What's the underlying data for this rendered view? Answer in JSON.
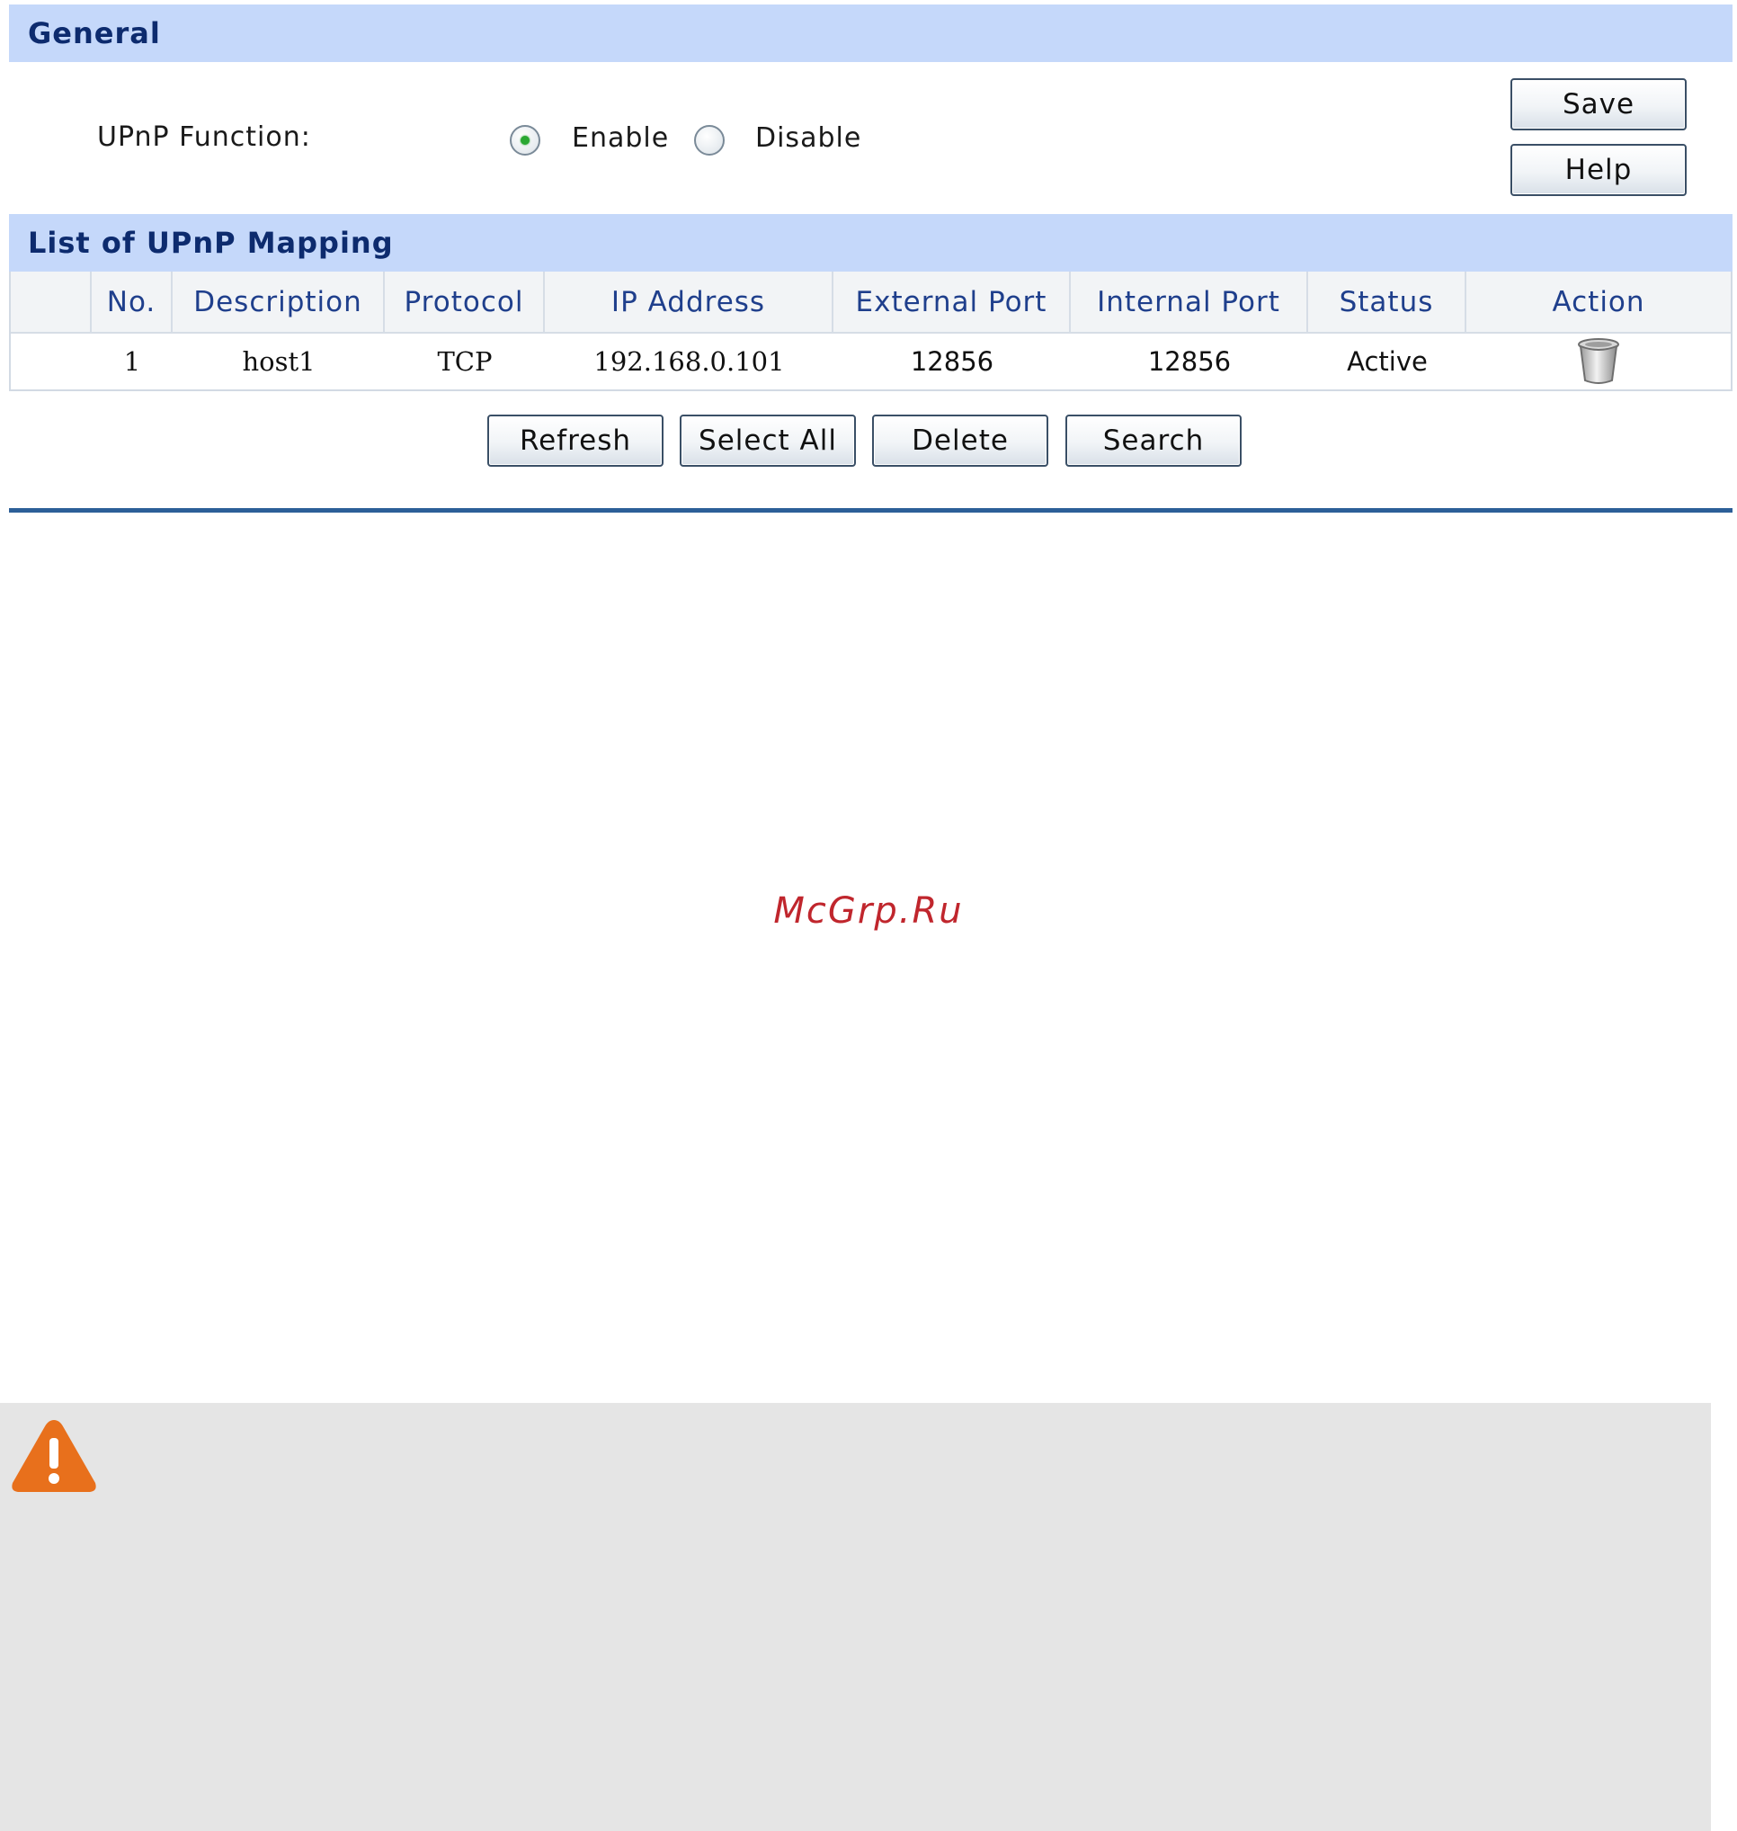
{
  "general": {
    "header": "General",
    "upnp_label": "UPnP Function:",
    "enable_label": "Enable",
    "disable_label": "Disable",
    "selected": "Enable",
    "save_label": "Save",
    "help_label": "Help"
  },
  "mapping": {
    "header": "List of UPnP Mapping",
    "columns": [
      "",
      "No.",
      "Description",
      "Protocol",
      "IP Address",
      "External Port",
      "Internal Port",
      "Status",
      "Action"
    ],
    "rows": [
      {
        "no": "1",
        "description": "host1",
        "protocol": "TCP",
        "ip": "192.168.0.101",
        "external_port": "12856",
        "internal_port": "12856",
        "status": "Active",
        "action_icon": "trash-icon"
      }
    ],
    "buttons": {
      "refresh": "Refresh",
      "select_all": "Select All",
      "delete": "Delete",
      "search": "Search"
    }
  },
  "watermark": "McGrp.Ru",
  "colors": {
    "section_header_bg": "#c5d8fa",
    "section_header_text": "#0d2b6e",
    "column_header_text": "#1f3f8c",
    "divider": "#2c5f98",
    "watermark": "#c0262d",
    "warning": "#e8701c",
    "note_bg": "#e5e5e5"
  },
  "icons": {
    "warning": "warning-icon",
    "delete_row": "trash-icon",
    "radio_selected": "radio-selected-icon",
    "radio_unselected": "radio-unselected-icon"
  }
}
